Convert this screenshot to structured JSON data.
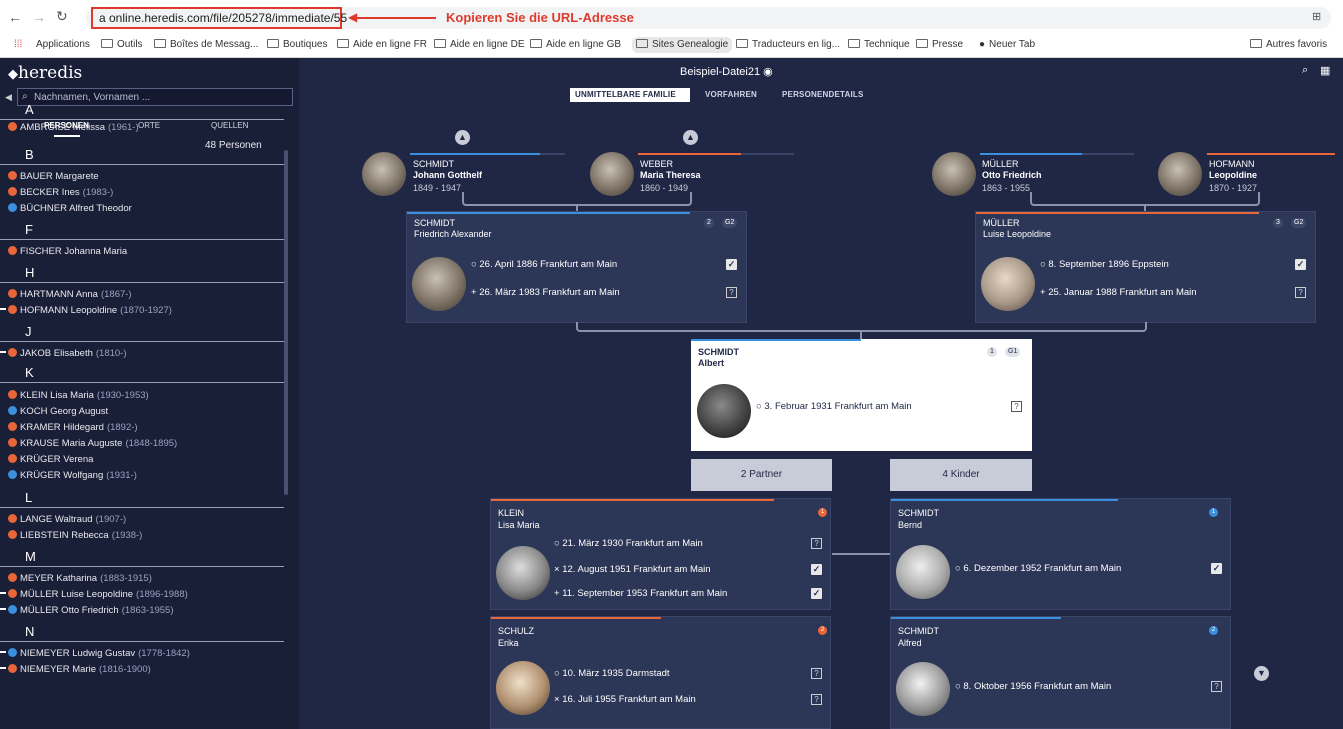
{
  "browser": {
    "url": "a  online.heredis.com/file/205278/immediate/55",
    "annotation": "Kopieren Sie die URL-Adresse",
    "bookmarks": [
      "Applications",
      "Outils",
      "Boîtes de Messag...",
      "Boutiques",
      "Aide en ligne FR",
      "Aide en ligne DE",
      "Aide en ligne GB",
      "Sites Genealogie",
      "Traducteurs en lig...",
      "Technique",
      "Presse",
      "Neuer Tab",
      "Autres favoris"
    ]
  },
  "app": {
    "logo": "heredis",
    "file": "Beispiel-Datei21",
    "tabs": [
      "UNMITTELBARE FAMILIE",
      "VORFAHREN",
      "PERSONENDETAILS"
    ]
  },
  "sidebar": {
    "search_placeholder": "Nachnamen, Vornamen ...",
    "tabs": [
      "PERSONEN",
      "ORTE",
      "QUELLEN"
    ],
    "count": "48 Personen",
    "groups": [
      {
        "letter": "A",
        "people": [
          {
            "name": "AMBROISE Melissa",
            "years": "(1961-)",
            "sex": "f",
            "dash": false
          }
        ]
      },
      {
        "letter": "B",
        "people": [
          {
            "name": "BAUER Margarete",
            "years": "",
            "sex": "f",
            "dash": false
          },
          {
            "name": "BECKER Ines",
            "years": "(1983-)",
            "sex": "f",
            "dash": false
          },
          {
            "name": "BÜCHNER Alfred Theodor",
            "years": "",
            "sex": "m",
            "dash": false
          }
        ]
      },
      {
        "letter": "F",
        "people": [
          {
            "name": "FISCHER Johanna Maria",
            "years": "",
            "sex": "f",
            "dash": false
          }
        ]
      },
      {
        "letter": "H",
        "people": [
          {
            "name": "HARTMANN Anna",
            "years": "(1867-)",
            "sex": "f",
            "dash": false
          },
          {
            "name": "HOFMANN Leopoldine",
            "years": "(1870-1927)",
            "sex": "f",
            "dash": true
          }
        ]
      },
      {
        "letter": "J",
        "people": [
          {
            "name": "JAKOB Elisabeth",
            "years": "(1810-)",
            "sex": "f",
            "dash": true
          }
        ]
      },
      {
        "letter": "K",
        "people": [
          {
            "name": "KLEIN Lisa Maria",
            "years": "(1930-1953)",
            "sex": "f",
            "dash": false
          },
          {
            "name": "KOCH Georg August",
            "years": "",
            "sex": "m",
            "dash": false
          },
          {
            "name": "KRAMER Hildegard",
            "years": "(1892-)",
            "sex": "f",
            "dash": false
          },
          {
            "name": "KRAUSE Maria Auguste",
            "years": "(1848-1895)",
            "sex": "f",
            "dash": false
          },
          {
            "name": "KRÜGER Verena",
            "years": "",
            "sex": "f",
            "dash": false
          },
          {
            "name": "KRÜGER Wolfgang",
            "years": "(1931-)",
            "sex": "m",
            "dash": false
          }
        ]
      },
      {
        "letter": "L",
        "people": [
          {
            "name": "LANGE Waltraud",
            "years": "(1907-)",
            "sex": "f",
            "dash": false
          },
          {
            "name": "LIEBSTEIN Rebecca",
            "years": "(1938-)",
            "sex": "f",
            "dash": false
          }
        ]
      },
      {
        "letter": "M",
        "people": [
          {
            "name": "MEYER Katharina",
            "years": "(1883-1915)",
            "sex": "f",
            "dash": false
          },
          {
            "name": "MÜLLER Luise Leopoldine",
            "years": "(1896-1988)",
            "sex": "f",
            "dash": true
          },
          {
            "name": "MÜLLER Otto Friedrich",
            "years": "(1863-1955)",
            "sex": "m",
            "dash": true
          }
        ]
      },
      {
        "letter": "N",
        "people": [
          {
            "name": "NIEMEYER Ludwig Gustav",
            "years": "(1778-1842)",
            "sex": "m",
            "dash": true
          },
          {
            "name": "NIEMEYER Marie",
            "years": "(1816-1900)",
            "sex": "f",
            "dash": true
          }
        ]
      }
    ]
  },
  "grandparents": [
    {
      "surname": "SCHMIDT",
      "given": "Johann Gotthelf",
      "years": "1849 - 1947"
    },
    {
      "surname": "WEBER",
      "given": "Maria Theresa",
      "years": "1860 - 1949"
    },
    {
      "surname": "MÜLLER",
      "given": "Otto Friedrich",
      "years": "1863 - 1955"
    },
    {
      "surname": "HOFMANN",
      "given": "Leopoldine",
      "years": "1870 - 1927"
    }
  ],
  "parents": [
    {
      "surname": "SCHMIDT",
      "given": "Friedrich Alexander",
      "badge1": "2",
      "badge2": "G2",
      "birth": "26. April 1886 Frankfurt am Main",
      "death": "26. März 1983 Frankfurt am Main"
    },
    {
      "surname": "MÜLLER",
      "given": "Luise Leopoldine",
      "badge1": "3",
      "badge2": "G2",
      "birth": "8. September 1896 Eppstein",
      "death": "25. Januar 1988 Frankfurt am Main"
    }
  ],
  "root": {
    "surname": "SCHMIDT",
    "given": "Albert",
    "badge1": "1",
    "badge2": "G1",
    "birth": "3. Februar 1931 Frankfurt am Main"
  },
  "buttons": {
    "partners": "2 Partner",
    "children": "4 Kinder"
  },
  "partners": [
    {
      "surname": "KLEIN",
      "given": "Lisa Maria",
      "num": "1",
      "birth": "21. März 1930 Frankfurt am Main",
      "marriage": "12. August 1951 Frankfurt am Main",
      "death": "11. September 1953 Frankfurt am Main"
    },
    {
      "surname": "SCHULZ",
      "given": "Erika",
      "num": "2",
      "birth": "10. März 1935 Darmstadt",
      "marriage": "16. Juli 1955 Frankfurt am Main"
    }
  ],
  "children": [
    {
      "surname": "SCHMIDT",
      "given": "Bernd",
      "num": "1",
      "birth": "6. Dezember 1952 Frankfurt am Main"
    },
    {
      "surname": "SCHMIDT",
      "given": "Alfred",
      "num": "2",
      "birth": "8. Oktober 1956 Frankfurt am Main"
    }
  ],
  "colors": {
    "male": "#3a8fde",
    "female": "#e8663a",
    "accent_red": "#e03a2c"
  }
}
